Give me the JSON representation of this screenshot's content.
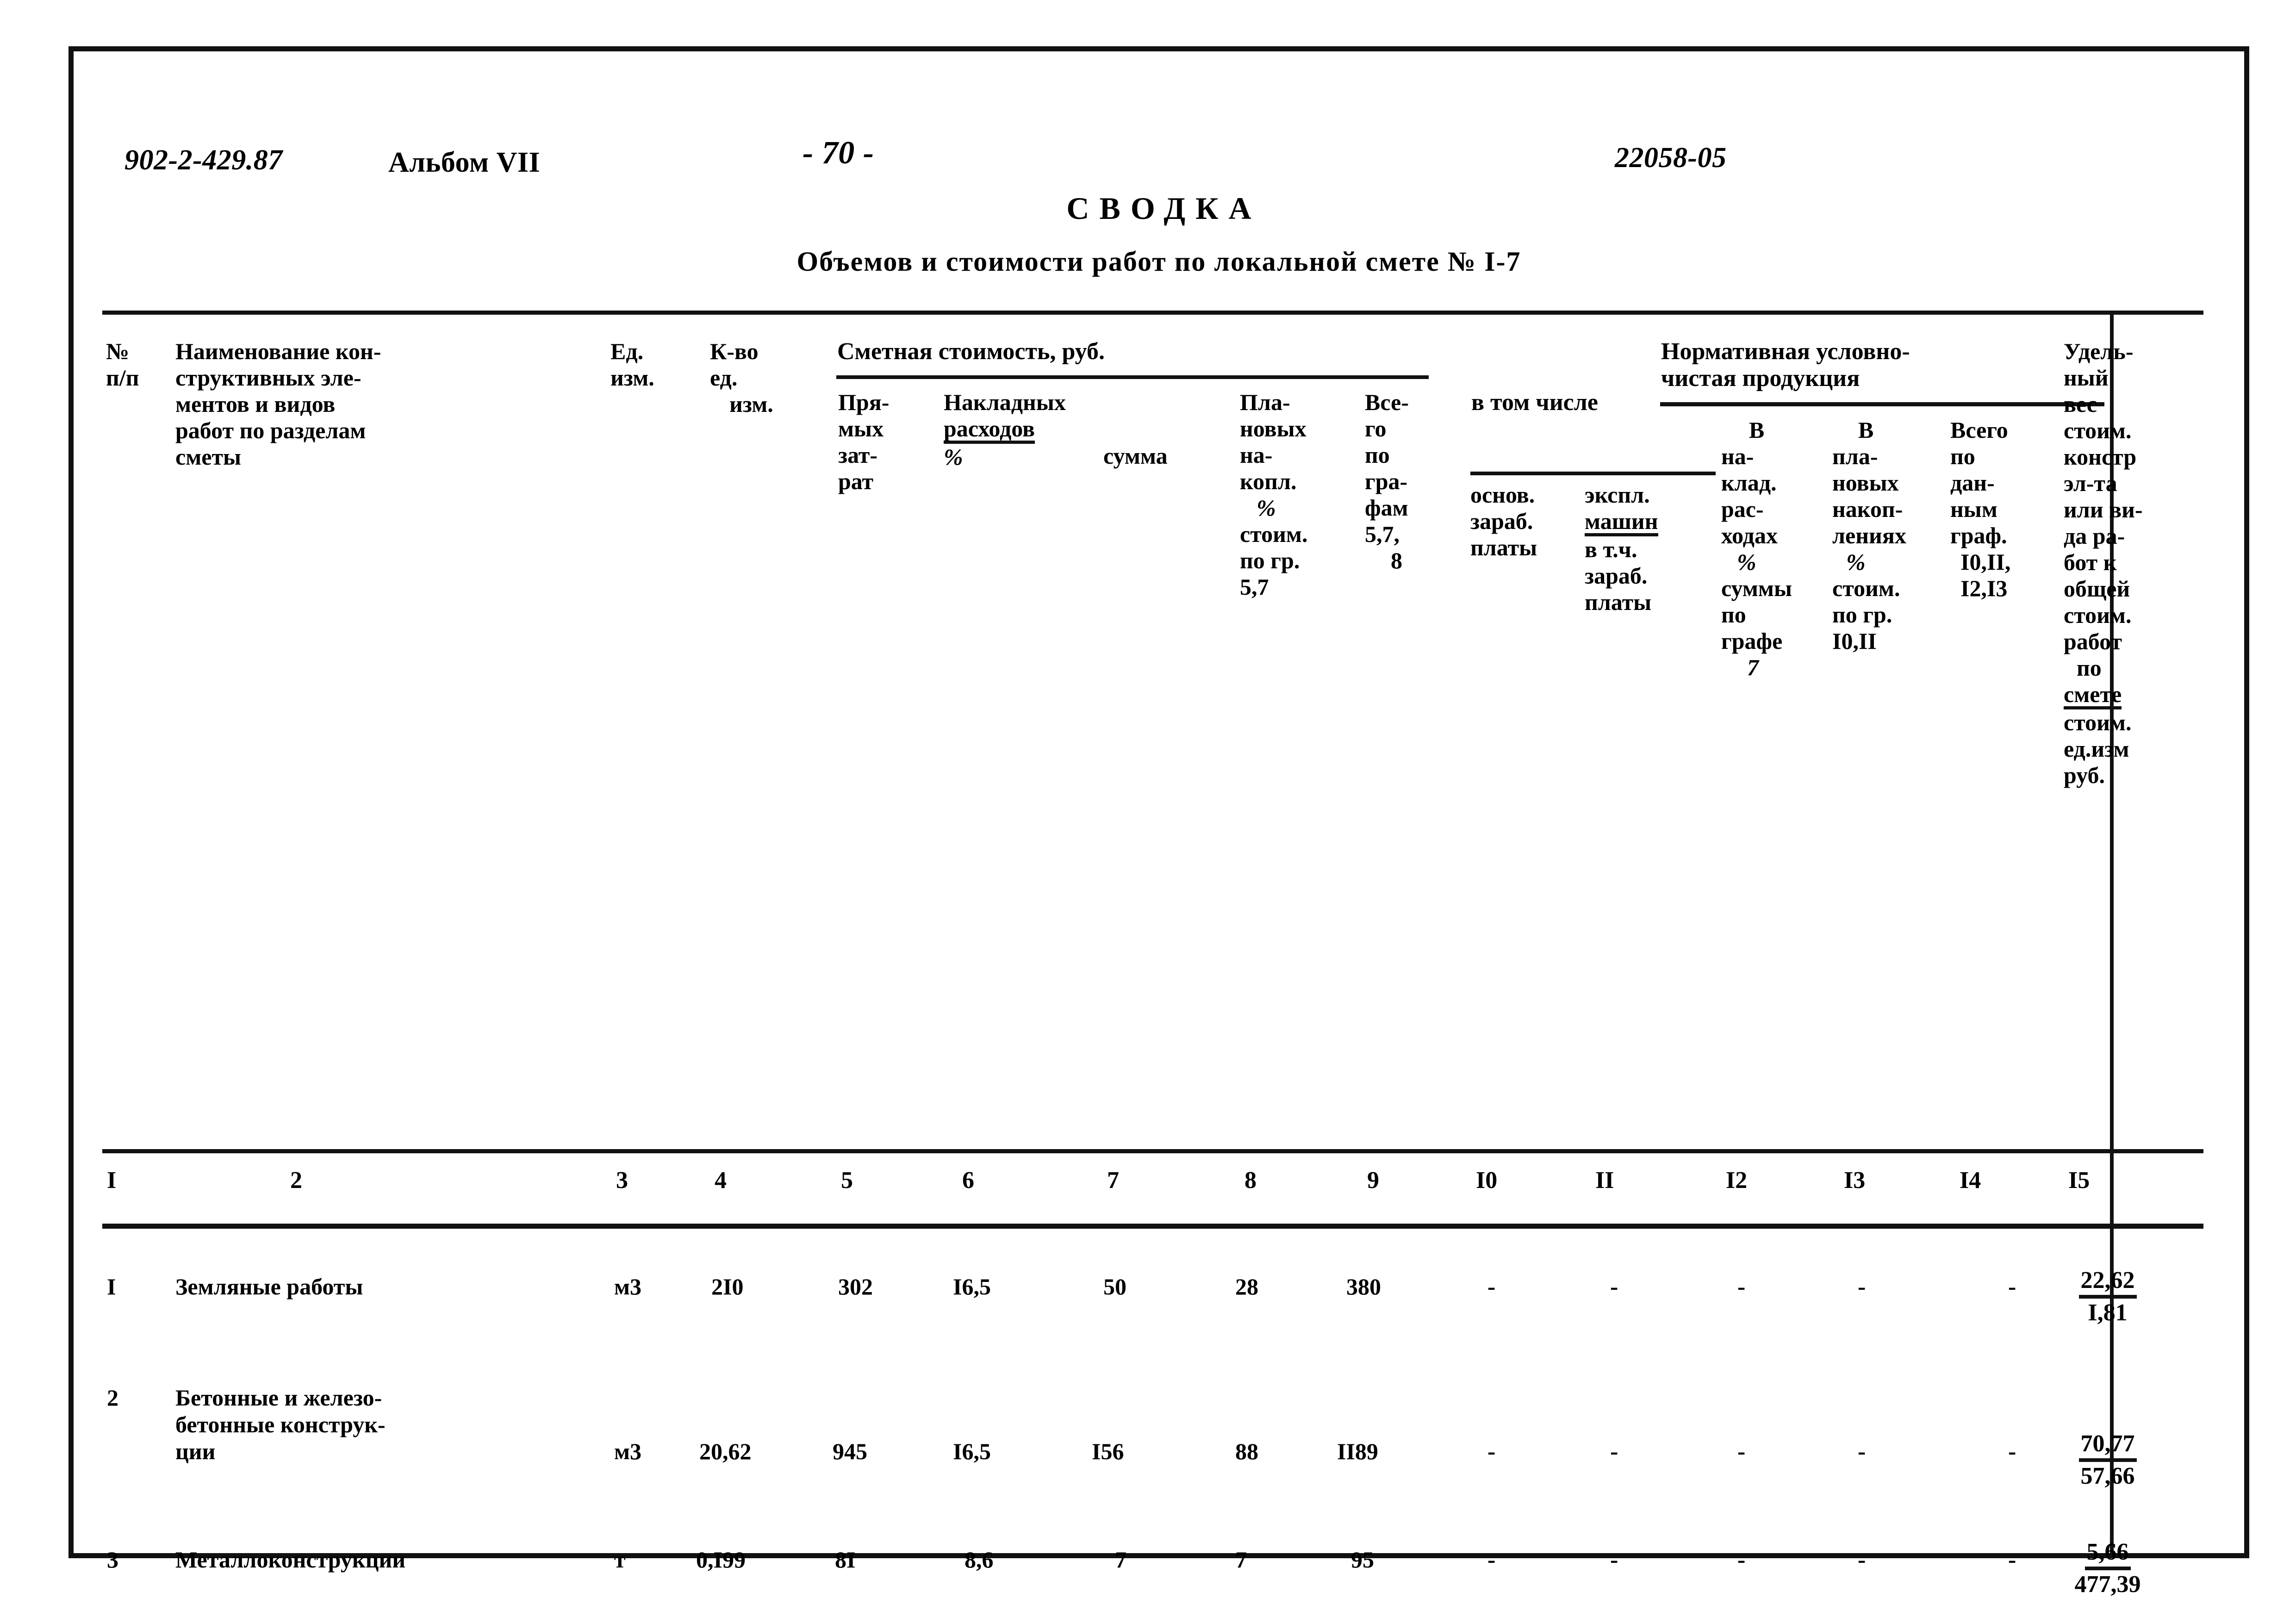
{
  "header": {
    "doc_code": "902-2-429.87",
    "album": "Альбом VII",
    "page_number": "- 70 -",
    "doc_number": "22058-05",
    "title": "СВОДКА",
    "subtitle": "Объемов и стоимости работ по локальной смете № I-7"
  },
  "table": {
    "group_headers": {
      "smetnaya": "Сметная стоимость, руб.",
      "normativnaya_l1": "Нормативная условно-",
      "normativnaya_l2": "чистая продукция",
      "v_tom_chisle": "в том числе"
    },
    "columns": [
      {
        "num": "I",
        "lines": [
          "№",
          "п/п"
        ]
      },
      {
        "num": "2",
        "lines": [
          "Наименование кон-",
          "структивных эле-",
          "ментов и видов",
          "работ по разделам",
          "сметы"
        ]
      },
      {
        "num": "3",
        "lines": [
          "Ед.",
          "изм."
        ]
      },
      {
        "num": "4",
        "lines": [
          "К-во",
          "ед.",
          "изм."
        ]
      },
      {
        "num": "5",
        "lines": [
          "Пря-",
          "мых",
          "зат-",
          "рат"
        ]
      },
      {
        "num": "6",
        "lines": [
          "Накладных",
          "расходов",
          "%"
        ]
      },
      {
        "num": "7",
        "lines": [
          "сумма"
        ]
      },
      {
        "num": "8",
        "lines": [
          "Пла-",
          "новых",
          "на-",
          "копл.",
          "%",
          "стоим.",
          "по гр.",
          "5,7"
        ]
      },
      {
        "num": "9",
        "lines": [
          "Все-",
          "го",
          "по",
          "гра-",
          "фам",
          "5,7,",
          "8"
        ]
      },
      {
        "num": "I0",
        "lines": [
          "основ.",
          "зараб.",
          "платы"
        ]
      },
      {
        "num": "II",
        "lines": [
          "экспл.",
          "машин",
          "в т.ч.",
          "зараб.",
          "платы"
        ]
      },
      {
        "num": "I2",
        "lines": [
          "В",
          "на-",
          "клад.",
          "рас-",
          "ходах",
          "%",
          "суммы",
          "по",
          "графе",
          "7"
        ]
      },
      {
        "num": "I3",
        "lines": [
          "В",
          "пла-",
          "новых",
          "накоп-",
          "лениях",
          "%",
          "стоим.",
          "по гр.",
          "I0,II"
        ]
      },
      {
        "num": "I4",
        "lines": [
          "Всего",
          "по",
          "дан-",
          "ным",
          "граф.",
          "I0,II,",
          "I2,I3"
        ]
      },
      {
        "num": "I5",
        "lines": [
          "Удель-",
          "ный",
          "вес",
          "стоим.",
          "констр",
          "эл-та",
          "или ви-",
          "да ра-",
          "бот к",
          "общей",
          "стоим.",
          "работ",
          "по",
          "смете",
          "стоим.",
          "ед.изм",
          "руб."
        ]
      }
    ],
    "rows": [
      {
        "num": "I",
        "name": [
          "Земляные работы"
        ],
        "unit": "м3",
        "qty": "2I0",
        "direct": "302",
        "overhead_pct": "I6,5",
        "overhead_sum": "50",
        "planned_pct": "28",
        "total": "380",
        "c10": "-",
        "c11": "-",
        "c12": "-",
        "c13": "-",
        "c14": "-",
        "share_top": "22,62",
        "share_bottom": "I,81"
      },
      {
        "num": "2",
        "name": [
          "Бетонные и железо-",
          "бетонные конструк-",
          "ции"
        ],
        "unit": "м3",
        "qty": "20,62",
        "direct": "945",
        "overhead_pct": "I6,5",
        "overhead_sum": "I56",
        "planned_pct": "88",
        "total": "II89",
        "c10": "-",
        "c11": "-",
        "c12": "-",
        "c13": "-",
        "c14": "-",
        "share_top": "70,77",
        "share_bottom": "57,66"
      },
      {
        "num": "3",
        "name": [
          "Металлоконструкции"
        ],
        "unit": "т",
        "qty": "0,I99",
        "direct": "8I",
        "overhead_pct": "8,6",
        "overhead_sum": "7",
        "planned_pct": "7",
        "total": "95",
        "c10": "-",
        "c11": "-",
        "c12": "-",
        "c13": "-",
        "c14": "-",
        "share_top": "5,66",
        "share_bottom": "477,39"
      }
    ]
  }
}
